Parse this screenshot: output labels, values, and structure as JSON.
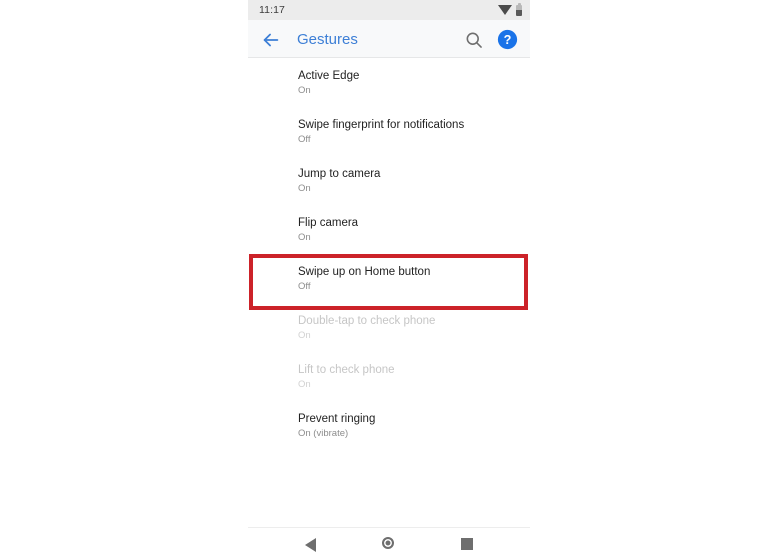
{
  "colors": {
    "accent_blue": "#3d7fd6",
    "help_blue": "#1a73e8",
    "highlight_red": "#cc2229",
    "status_bar_bg": "#ececec",
    "toolbar_bg": "#f8f9fa",
    "screen_bg": "#ffffff",
    "title_text": "#222222",
    "subtitle_text": "#8d8d8d",
    "disabled_text": "#c6c6c6"
  },
  "status_bar": {
    "time": "11:17",
    "icons": [
      {
        "name": "wifi-icon"
      },
      {
        "name": "battery-icon"
      }
    ]
  },
  "toolbar": {
    "back_icon": "back-arrow-icon",
    "title": "Gestures",
    "search_icon": "search-icon",
    "help_icon": "help-icon"
  },
  "settings_list": {
    "items": [
      {
        "title": "Active Edge",
        "subtitle": "On",
        "disabled": false,
        "highlighted": false
      },
      {
        "title": "Swipe fingerprint for notifications",
        "subtitle": "Off",
        "disabled": false,
        "highlighted": false
      },
      {
        "title": "Jump to camera",
        "subtitle": "On",
        "disabled": false,
        "highlighted": false
      },
      {
        "title": "Flip camera",
        "subtitle": "On",
        "disabled": false,
        "highlighted": false
      },
      {
        "title": "Swipe up on Home button",
        "subtitle": "Off",
        "disabled": false,
        "highlighted": true
      },
      {
        "title": "Double-tap to check phone",
        "subtitle": "On",
        "disabled": true,
        "highlighted": false
      },
      {
        "title": "Lift to check phone",
        "subtitle": "On",
        "disabled": true,
        "highlighted": false
      },
      {
        "title": "Prevent ringing",
        "subtitle": "On (vibrate)",
        "disabled": false,
        "highlighted": false
      }
    ]
  },
  "nav_bar": {
    "back_icon": "nav-back-icon",
    "home_icon": "nav-home-icon",
    "recents_icon": "nav-recents-icon"
  }
}
